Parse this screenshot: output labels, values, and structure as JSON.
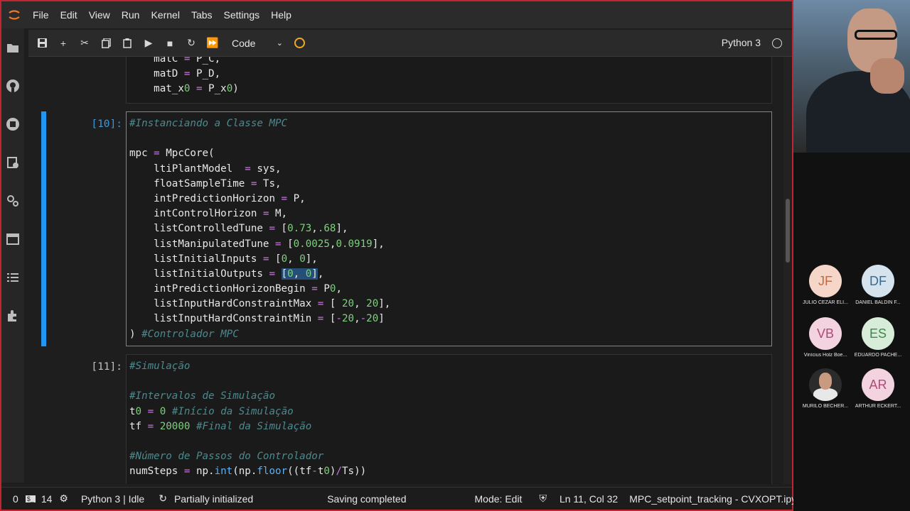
{
  "menubar": {
    "items": [
      "File",
      "Edit",
      "View",
      "Run",
      "Kernel",
      "Tabs",
      "Settings",
      "Help"
    ]
  },
  "sidebar": {
    "icons": [
      "folder-icon",
      "github-icon",
      "running-icon",
      "commands-icon",
      "extension-settings-icon",
      "tabs-icon",
      "toc-icon",
      "puzzle-icon"
    ]
  },
  "toolbar": {
    "cell_type": "Code",
    "kernel": "Python 3"
  },
  "cells": [
    {
      "prompt": "",
      "lines": [
        "    matC = P_C,",
        "    matD = P_D,",
        "    mat_x0 = P_x0)"
      ]
    },
    {
      "prompt": "[10]:",
      "lines": [
        "#Instanciando a Classe MPC",
        "",
        "mpc = MpcCore(",
        "    ltiPlantModel  = sys,",
        "    floatSampleTime = Ts,",
        "    intPredictionHorizon = P,",
        "    intControlHorizon = M,",
        "    listControlledTune = [0.73,.68],",
        "    listManipulatedTune = [0.0025,0.0919],",
        "    listInitialInputs = [0, 0],",
        "    listInitialOutputs = [0, 0],",
        "    intPredictionHorizonBegin = P0,",
        "    listInputHardConstraintMax = [ 20, 20],",
        "    listInputHardConstraintMin = [-20,-20]",
        ") #Controlador MPC"
      ]
    },
    {
      "prompt": "[11]:",
      "lines": [
        "#Simulação",
        "",
        "#Intervalos de Simulação",
        "t0 = 0 #Início da Simulação",
        "tf = 20000 #Final da Simulação",
        "",
        "#Número de Passos do Controlador",
        "numSteps = np.int(np.floor((tf-t0)/Ts))"
      ]
    }
  ],
  "statusbar": {
    "count_a": "0",
    "count_b": "14",
    "kernel_status": "Python 3 | Idle",
    "init_status": "Partially initialized",
    "save_status": "Saving completed",
    "mode": "Mode: Edit",
    "cursor": "Ln 11, Col 32",
    "filename": "MPC_setpoint_tracking - CVXOPT.ipynb"
  },
  "participants": [
    {
      "initials": "JF",
      "name": "JÚLIO CEZAR ELI...",
      "color": "#f6d6c8"
    },
    {
      "initials": "DF",
      "name": "DANIEL BALDIN F...",
      "color": "#d5e3ee"
    },
    {
      "initials": "VB",
      "name": "Vinícius Holz Boe...",
      "color": "#f3d3e0"
    },
    {
      "initials": "ES",
      "name": "EDUARDO PACHE...",
      "color": "#d7ecd9"
    },
    {
      "initials": "",
      "name": "MURILO BECHER...",
      "color": "#2b2b2b"
    },
    {
      "initials": "AR",
      "name": "ARTHUR ECKERT...",
      "color": "#f3d3e0"
    }
  ]
}
